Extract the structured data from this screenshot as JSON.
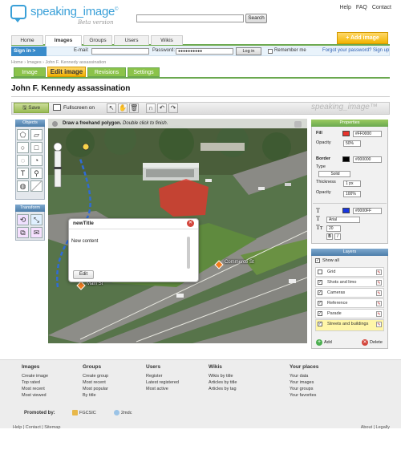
{
  "header": {
    "logo_text": "speaking_image",
    "logo_tm": "©",
    "logo_sub": "Beta version",
    "links": [
      "Help",
      "FAQ",
      "Contact"
    ],
    "search_button": "Search"
  },
  "nav": {
    "tabs": [
      "Home",
      "Images",
      "Groups",
      "Users",
      "Wikis"
    ],
    "active": "Images",
    "add_image": "Add image"
  },
  "signin": {
    "label": "Sign in >",
    "email_label": "E-mail:",
    "password_label": "Password:",
    "password_value": "●●●●●●●●●●",
    "login_button": "Log in",
    "remember": "Remember me",
    "forgot": "Forgot your password?",
    "signup": "Sign up"
  },
  "breadcrumb": "Home › Images › John F. Kennedy assassination",
  "subtabs": [
    "Image",
    "Edit image",
    "Revisions",
    "Settings"
  ],
  "page_title": "John F. Kennedy assassination",
  "toolbar": {
    "save": "Save",
    "fullscreen": "Fullscreen on",
    "watermark": "speaking_image™"
  },
  "left_panels": {
    "objects": "Objects",
    "transform": "Transform"
  },
  "map": {
    "hint_bold": "Draw a freehand polygon.",
    "hint_italic": "Double click to finish.",
    "labels": [
      "Commerce St",
      "Main St"
    ]
  },
  "popup": {
    "title": "newTitle",
    "close": "✕",
    "content": "New content",
    "edit": "Edit"
  },
  "properties": {
    "header": "Properties",
    "fill_label": "Fill",
    "fill_color": "#FF0000",
    "opacity_label": "Opacity",
    "fill_opacity": "50%",
    "border_label": "Border",
    "border_color": "#000000",
    "type_label": "Type",
    "type_value": "Solid",
    "thickness_label": "Thickness",
    "thickness_value": "1 px",
    "border_opacity": "100%",
    "text_color": "#0000FF",
    "font": "Arial",
    "size": "20",
    "bold": "B",
    "italic": "I",
    "fill_hex": "#e8332c",
    "text_hex": "#1836e0"
  },
  "layers": {
    "header": "Layers",
    "show_all": "Show all",
    "items": [
      "Grid",
      "Shots and limo",
      "Cameras",
      "Reference",
      "Parade",
      "Streets and buildings"
    ],
    "add": "Add",
    "delete": "Delete"
  },
  "footer": {
    "columns": [
      {
        "title": "Images",
        "items": [
          "Create image",
          "Top rated",
          "Most recent",
          "Most viewed"
        ]
      },
      {
        "title": "Groups",
        "items": [
          "Create group",
          "Most recent",
          "Most popular",
          "By title"
        ]
      },
      {
        "title": "Users",
        "items": [
          "Register",
          "Latest registered",
          "Most active"
        ]
      },
      {
        "title": "Wikis",
        "items": [
          "Wikis by title",
          "Articles by title",
          "Articles by tag"
        ]
      },
      {
        "title": "Your places",
        "items": [
          "Your data",
          "Your images",
          "Your groups",
          "Your favorites"
        ]
      }
    ],
    "promoted_by": "Promoted by:",
    "sponsors": [
      "FGCSIC",
      "2mdc"
    ],
    "bottom_left": "Help | Contact | Sitemap",
    "bottom_right": "About | Legally"
  }
}
